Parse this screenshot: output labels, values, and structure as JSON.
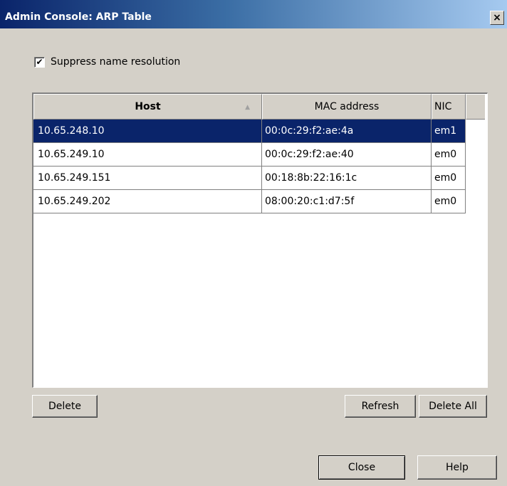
{
  "window": {
    "title": "Admin Console: ARP Table",
    "close_glyph": "×"
  },
  "options": {
    "suppress_label": "Suppress name resolution",
    "suppress_checked": true,
    "check_glyph": "✔"
  },
  "table": {
    "columns": {
      "host": "Host",
      "mac": "MAC address",
      "nic": "NIC"
    },
    "sort_glyph": "▲",
    "sort_column": "host",
    "sort_direction": "ascending",
    "rows": [
      {
        "host": "10.65.248.10",
        "mac": "00:0c:29:f2:ae:4a",
        "nic": "em1",
        "selected": true
      },
      {
        "host": "10.65.249.10",
        "mac": "00:0c:29:f2:ae:40",
        "nic": "em0",
        "selected": false
      },
      {
        "host": "10.65.249.151",
        "mac": "00:18:8b:22:16:1c",
        "nic": "em0",
        "selected": false
      },
      {
        "host": "10.65.249.202",
        "mac": "08:00:20:c1:d7:5f",
        "nic": "em0",
        "selected": false
      }
    ]
  },
  "buttons": {
    "delete": "Delete",
    "refresh": "Refresh",
    "delete_all": "Delete All",
    "close": "Close",
    "help": "Help"
  },
  "colors": {
    "selection": "#0a246a",
    "window_bg": "#d4d0c8",
    "title_start": "#0a246a",
    "title_end": "#a6caf0"
  }
}
